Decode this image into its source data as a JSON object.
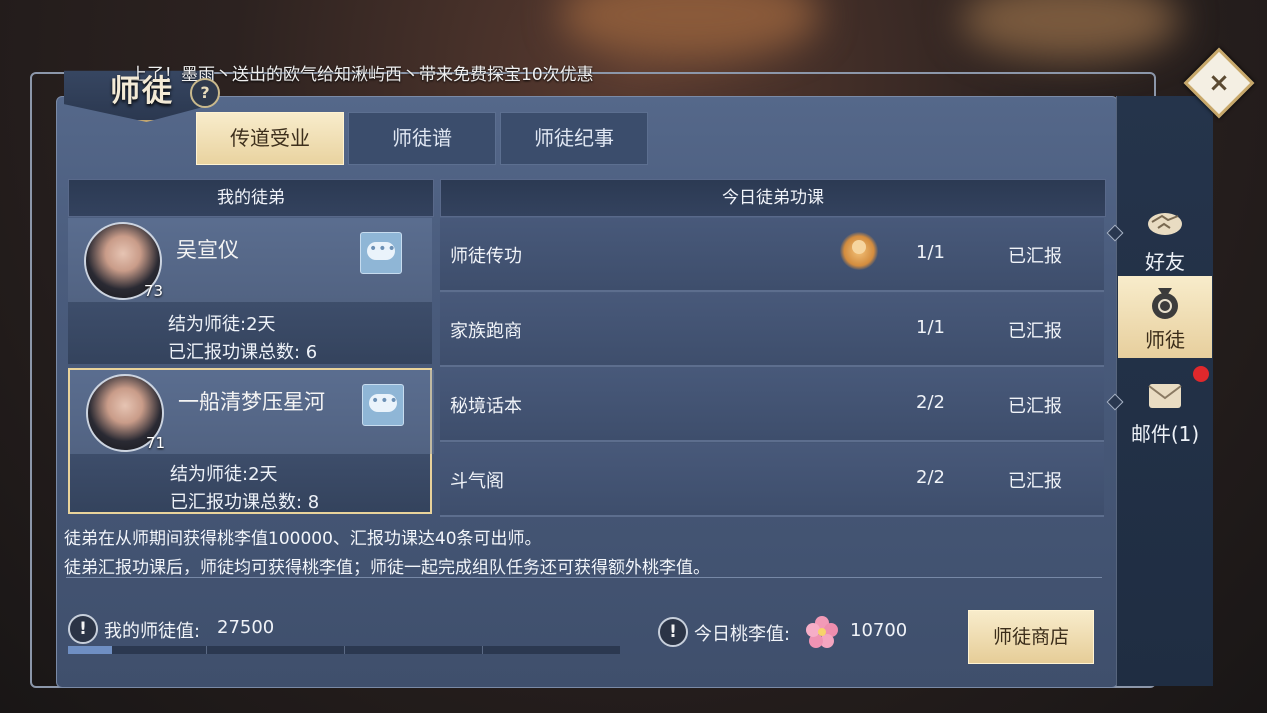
{
  "header": {
    "title": "师徒",
    "help_symbol": "?",
    "marquee": "上了！墨雨丶送出的欧气给知湫屿西丶带来免费探宝10次优惠",
    "close_symbol": "×"
  },
  "tabs": [
    {
      "label": "传道受业",
      "active": true
    },
    {
      "label": "师徒谱",
      "active": false
    },
    {
      "label": "师徒纪事",
      "active": false
    }
  ],
  "students_header": "我的徒弟",
  "students": [
    {
      "name": "吴宣仪",
      "level": "73",
      "days": "结为师徒:2天",
      "reports": "已汇报功课总数: 6",
      "selected": false
    },
    {
      "name": "一船清梦压星河",
      "level": "71",
      "days": "结为师徒:2天",
      "reports": "已汇报功课总数: 8",
      "selected": true
    }
  ],
  "tasks_header": "今日徒弟功课",
  "tasks": [
    {
      "name": "师徒传功",
      "count": "1/1",
      "status": "已汇报",
      "icon": "meditation-icon"
    },
    {
      "name": "家族跑商",
      "count": "1/1",
      "status": "已汇报"
    },
    {
      "name": "秘境话本",
      "count": "2/2",
      "status": "已汇报"
    },
    {
      "name": "斗气阁",
      "count": "2/2",
      "status": "已汇报"
    }
  ],
  "description": [
    "徒弟在从师期间获得桃李值100000、汇报功课达40条可出师。",
    "徒弟汇报功课后，师徒均可获得桃李值；师徒一起完成组队任务还可获得额外桃李值。"
  ],
  "footer": {
    "mentor_value_label": "我的师徒值:",
    "mentor_value": "27500",
    "mentor_progress": 0.08,
    "peach_label": "今日桃李值:",
    "peach_value": "10700",
    "shop_button": "师徒商店",
    "info_symbol": "!"
  },
  "sidebar": [
    {
      "label": "好友",
      "icon": "handshake-icon",
      "active": false
    },
    {
      "label": "师徒",
      "icon": "money-bag-icon",
      "active": true
    },
    {
      "label": "邮件(1)",
      "icon": "mail-icon",
      "active": false,
      "badge": true
    }
  ],
  "colors": {
    "accent_gold": "#e9d3a0",
    "panel_blue": "#4a5c7d",
    "notification_red": "#e0282c"
  }
}
